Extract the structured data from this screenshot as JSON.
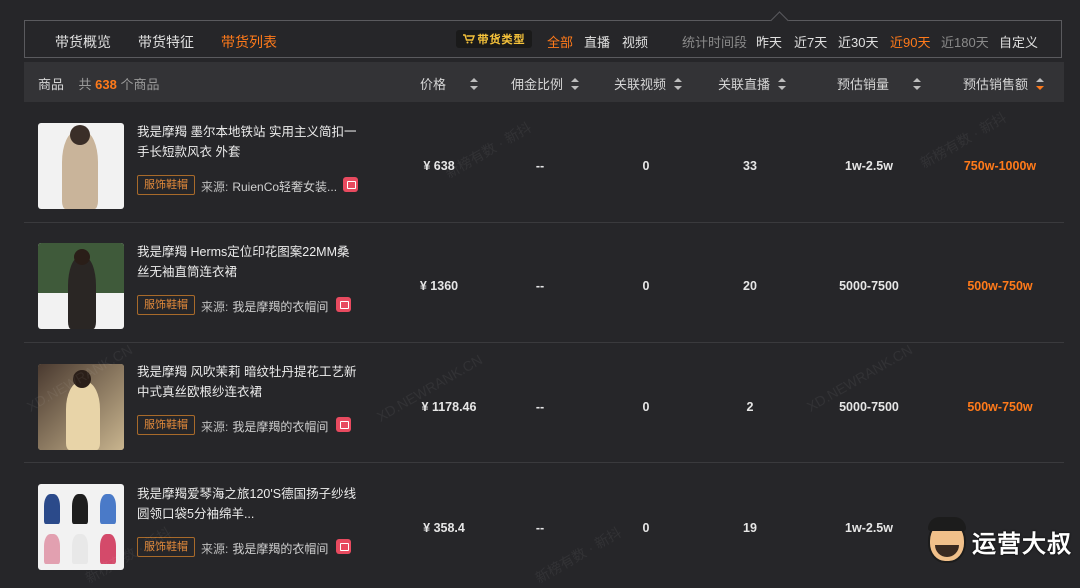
{
  "tabs": [
    {
      "label": "带货概览",
      "active": false
    },
    {
      "label": "带货特征",
      "active": false
    },
    {
      "label": "带货列表",
      "active": true
    }
  ],
  "type_badge": "带货类型",
  "type_filters": [
    {
      "label": "全部",
      "active": true
    },
    {
      "label": "直播",
      "active": false
    },
    {
      "label": "视频",
      "active": false
    }
  ],
  "time_filter_label": "统计时间段",
  "time_filters": [
    {
      "label": "昨天",
      "active": false,
      "dim": false
    },
    {
      "label": "近7天",
      "active": false,
      "dim": false
    },
    {
      "label": "近30天",
      "active": false,
      "dim": false
    },
    {
      "label": "近90天",
      "active": true,
      "dim": false
    },
    {
      "label": "近180天",
      "active": false,
      "dim": true
    },
    {
      "label": "自定义",
      "active": false,
      "dim": false
    }
  ],
  "table": {
    "product_label": "商品",
    "count_prefix": "共",
    "count": "638",
    "count_suffix": "个商品",
    "columns": [
      "价格",
      "佣金比例",
      "关联视频",
      "关联直播",
      "预估销量",
      "预估销售额"
    ],
    "rows": [
      {
        "title": "我是摩羯 墨尔本地铁站 实用主义简扣一手长短款风衣 外套",
        "tag": "服饰鞋帽",
        "source_label": "来源:",
        "source": "RuienCo轻奢女装...",
        "price": "¥ 638",
        "commission": "--",
        "videos": "0",
        "lives": "33",
        "sales": "1w-2.5w",
        "revenue": "750w-1000w"
      },
      {
        "title": "我是摩羯 Herms定位印花图案22MM桑丝无袖直筒连衣裙",
        "tag": "服饰鞋帽",
        "source_label": "来源:",
        "source": "我是摩羯的衣帽间",
        "price": "¥ 1360",
        "commission": "--",
        "videos": "0",
        "lives": "20",
        "sales": "5000-7500",
        "revenue": "500w-750w"
      },
      {
        "title": "我是摩羯 风吹茉莉 暗纹牡丹提花工艺新中式真丝欧根纱连衣裙",
        "tag": "服饰鞋帽",
        "source_label": "来源:",
        "source": "我是摩羯的衣帽间",
        "price": "¥ 1178.46",
        "commission": "--",
        "videos": "0",
        "lives": "2",
        "sales": "5000-7500",
        "revenue": "500w-750w"
      },
      {
        "title": "我是摩羯爱琴海之旅120'S德国扬子纱线圆领口袋5分袖绵羊...",
        "tag": "服饰鞋帽",
        "source_label": "来源:",
        "source": "我是摩羯的衣帽间",
        "price": "¥ 358.4",
        "commission": "--",
        "videos": "0",
        "lives": "19",
        "sales": "1w-2.5w",
        "revenue": ""
      }
    ]
  },
  "watermarks": [
    "新榜有数 · 新抖",
    "XD.NEWRANK.CN"
  ],
  "brand_name": "运营大叔",
  "colors": {
    "accent": "#ff7a1a",
    "background": "#262629",
    "header": "#333336",
    "shop_icon": "#e84a5f"
  }
}
